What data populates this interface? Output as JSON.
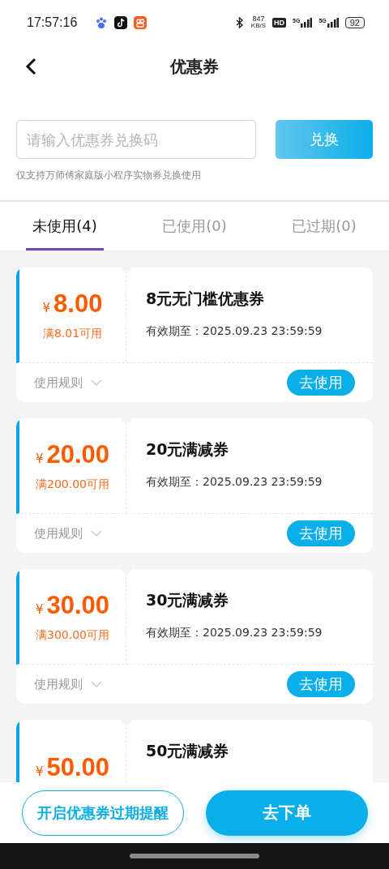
{
  "status_bar": {
    "time": "17:57:16",
    "speed_value": "847",
    "speed_unit": "KB/S",
    "hd": "HD",
    "signal_1": "5G",
    "signal_2": "5G",
    "battery": "92"
  },
  "header": {
    "title": "优惠券"
  },
  "redeem": {
    "placeholder": "请输入优惠券兑换码",
    "button": "兑换",
    "hint": "仅支持万师傅家庭版小程序实物券兑换使用"
  },
  "tabs": [
    {
      "label": "未使用(4)",
      "selected": true
    },
    {
      "label": "已使用(0)",
      "selected": false
    },
    {
      "label": "已过期(0)",
      "selected": false
    }
  ],
  "coupons": [
    {
      "currency": "¥",
      "amount": "8.00",
      "condition": "满8.01可用",
      "title": "8元无门槛优惠券",
      "expiry": "有效期至：2025.09.23 23:59:59",
      "rules": "使用规则",
      "button": "去使用"
    },
    {
      "currency": "¥",
      "amount": "20.00",
      "condition": "满200.00可用",
      "title": "20元满减券",
      "expiry": "有效期至：2025.09.23 23:59:59",
      "rules": "使用规则",
      "button": "去使用"
    },
    {
      "currency": "¥",
      "amount": "30.00",
      "condition": "满300.00可用",
      "title": "30元满减券",
      "expiry": "有效期至：2025.09.23 23:59:59",
      "rules": "使用规则",
      "button": "去使用"
    },
    {
      "currency": "¥",
      "amount": "50.00",
      "title": "50元满减券"
    }
  ],
  "bottom_bar": {
    "reminder_button": "开启优惠券过期提醒",
    "order_button": "去下单"
  }
}
